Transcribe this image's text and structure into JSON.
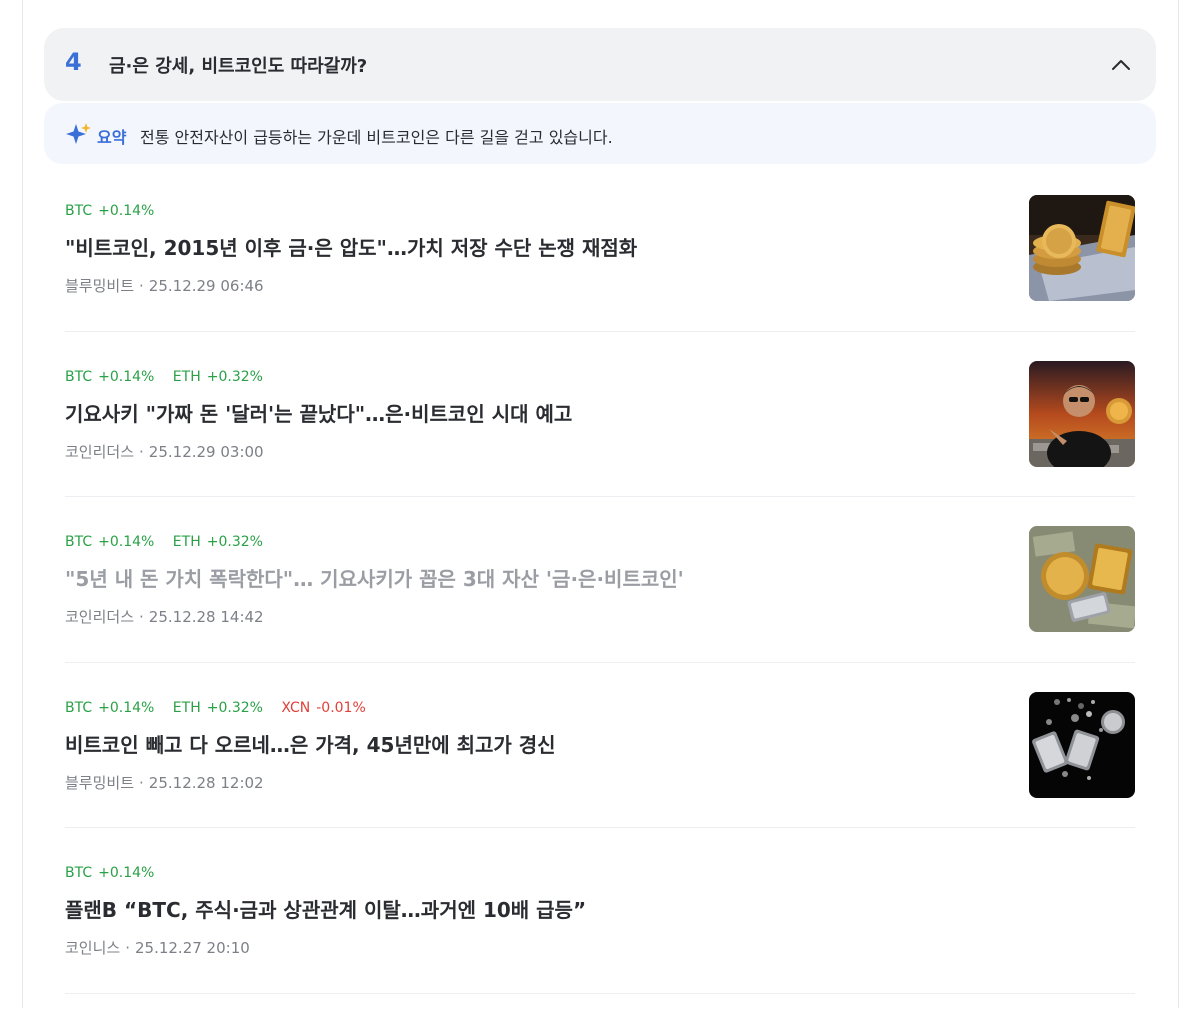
{
  "topic": {
    "number": "4",
    "title": "금·은 강세, 비트코인도 따라갈까?"
  },
  "summary": {
    "label": "요약",
    "text": "전통 안전자산이 급등하는 가운데 비트코인은 다른 길을 걷고 있습니다.",
    "icon": "sparkle-icon"
  },
  "colors": {
    "up": "#2aa147",
    "down": "#e0413a",
    "accent": "#3a6fd8"
  },
  "articles": [
    {
      "tickers": [
        {
          "symbol": "BTC",
          "change": "+0.14%",
          "direction": "up"
        }
      ],
      "headline": "\"비트코인, 2015년 이후 금·은 압도\"…가치 저장 수단 논쟁 재점화",
      "source": "블루밍비트",
      "datetime": "25.12.29 06:46",
      "thumbnail": "bitcoin-gold-dollar-thumbnail",
      "visited": false
    },
    {
      "tickers": [
        {
          "symbol": "BTC",
          "change": "+0.14%",
          "direction": "up"
        },
        {
          "symbol": "ETH",
          "change": "+0.32%",
          "direction": "up"
        }
      ],
      "headline": "기요사키 \"가짜 돈 '달러'는 끝났다\"…은·비트코인 시대 예고",
      "source": "코인리더스",
      "datetime": "25.12.29 03:00",
      "thumbnail": "kiyosaki-thumbnail",
      "visited": false
    },
    {
      "tickers": [
        {
          "symbol": "BTC",
          "change": "+0.14%",
          "direction": "up"
        },
        {
          "symbol": "ETH",
          "change": "+0.32%",
          "direction": "up"
        }
      ],
      "headline": "\"5년 내 돈 가치 폭락한다\"… 기요사키가 꼽은 3대 자산 '금·은·비트코인'",
      "source": "코인리더스",
      "datetime": "25.12.28 14:42",
      "thumbnail": "gold-silver-bitcoin-thumbnail",
      "visited": true
    },
    {
      "tickers": [
        {
          "symbol": "BTC",
          "change": "+0.14%",
          "direction": "up"
        },
        {
          "symbol": "ETH",
          "change": "+0.32%",
          "direction": "up"
        },
        {
          "symbol": "XCN",
          "change": "-0.01%",
          "direction": "down"
        }
      ],
      "headline": "비트코인 빼고 다 오르네…은 가격, 45년만에 최고가 경신",
      "source": "블루밍비트",
      "datetime": "25.12.28 12:02",
      "thumbnail": "silver-bars-thumbnail",
      "visited": false
    },
    {
      "tickers": [
        {
          "symbol": "BTC",
          "change": "+0.14%",
          "direction": "up"
        }
      ],
      "headline": "플랜B “BTC, 주식·금과 상관관계 이탈…과거엔 10배 급등”",
      "source": "코인니스",
      "datetime": "25.12.27 20:10",
      "thumbnail": null,
      "visited": false
    }
  ]
}
